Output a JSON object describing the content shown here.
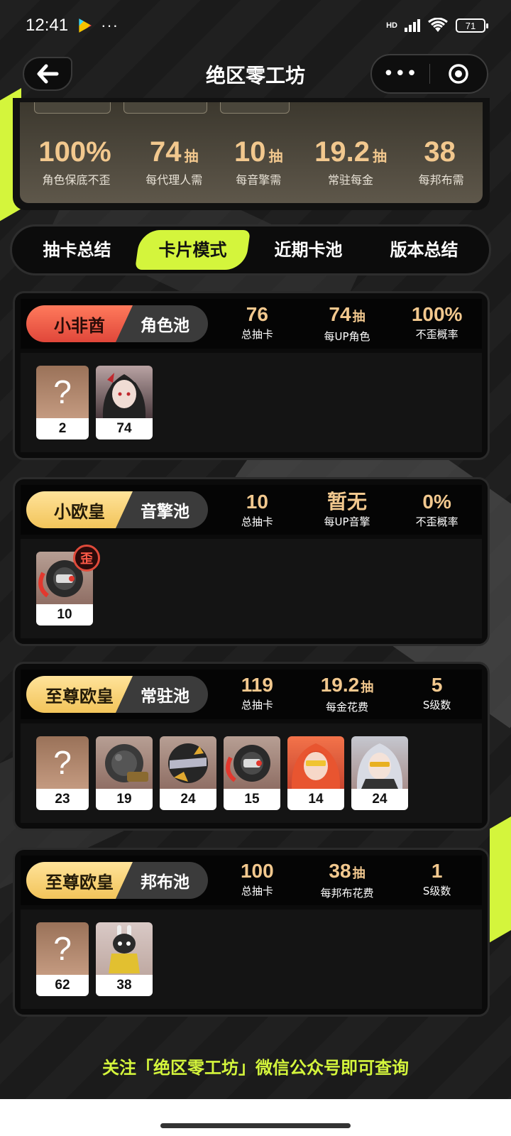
{
  "status_bar": {
    "time": "12:41",
    "dots": "···",
    "hd": "HD",
    "battery": "71"
  },
  "header": {
    "title": "绝区零工坊",
    "more": "•••"
  },
  "summary": {
    "stats": [
      {
        "value": "100%",
        "unit": "",
        "label": "角色保底不歪"
      },
      {
        "value": "74",
        "unit": "抽",
        "label": "每代理人需"
      },
      {
        "value": "10",
        "unit": "抽",
        "label": "每音擎需"
      },
      {
        "value": "19.2",
        "unit": "抽",
        "label": "常驻每金"
      },
      {
        "value": "38",
        "unit": "",
        "label": "每邦布需"
      }
    ]
  },
  "tabs": [
    {
      "label": "抽卡总结"
    },
    {
      "label": "卡片模式"
    },
    {
      "label": "近期卡池"
    },
    {
      "label": "版本总结"
    }
  ],
  "pools": [
    {
      "rank": "小非酋",
      "type": "角色池",
      "stats": [
        {
          "value": "76",
          "unit": "",
          "label": "总抽卡"
        },
        {
          "value": "74",
          "unit": "抽",
          "label": "每UP角色"
        },
        {
          "value": "100%",
          "unit": "",
          "label": "不歪概率"
        }
      ],
      "cards": [
        {
          "kind": "unknown",
          "mark": "?",
          "count": "2"
        },
        {
          "kind": "character-portrait",
          "count": "74"
        }
      ]
    },
    {
      "rank": "小欧皇",
      "type": "音擎池",
      "stats": [
        {
          "value": "10",
          "unit": "",
          "label": "总抽卡"
        },
        {
          "value": "暂无",
          "unit": "",
          "label": "每UP音擎"
        },
        {
          "value": "0%",
          "unit": "",
          "label": "不歪概率"
        }
      ],
      "cards": [
        {
          "kind": "w-engine",
          "count": "10",
          "badge": "歪"
        }
      ]
    },
    {
      "rank": "至尊欧皇",
      "type": "常驻池",
      "stats": [
        {
          "value": "119",
          "unit": "",
          "label": "总抽卡"
        },
        {
          "value": "19.2",
          "unit": "抽",
          "label": "每金花费"
        },
        {
          "value": "5",
          "unit": "",
          "label": "S级数"
        }
      ],
      "cards": [
        {
          "kind": "unknown",
          "mark": "?",
          "count": "23"
        },
        {
          "kind": "w-engine",
          "count": "19"
        },
        {
          "kind": "w-engine",
          "count": "24"
        },
        {
          "kind": "w-engine",
          "count": "15"
        },
        {
          "kind": "character-portrait",
          "count": "14"
        },
        {
          "kind": "character-portrait",
          "count": "24"
        }
      ]
    },
    {
      "rank": "至尊欧皇",
      "type": "邦布池",
      "stats": [
        {
          "value": "100",
          "unit": "",
          "label": "总抽卡"
        },
        {
          "value": "38",
          "unit": "抽",
          "label": "每邦布花费"
        },
        {
          "value": "1",
          "unit": "",
          "label": "S级数"
        }
      ],
      "cards": [
        {
          "kind": "unknown",
          "mark": "?",
          "count": "62"
        },
        {
          "kind": "bangboo-portrait",
          "count": "38"
        }
      ]
    }
  ],
  "footer": {
    "text": "关注「绝区零工坊」微信公众号即可查询"
  },
  "colors": {
    "accent_lime": "#d4f53c",
    "stat_gold": "#f2c88e",
    "rank_red": "#e0473a",
    "rank_gold": "#f2c45a"
  }
}
